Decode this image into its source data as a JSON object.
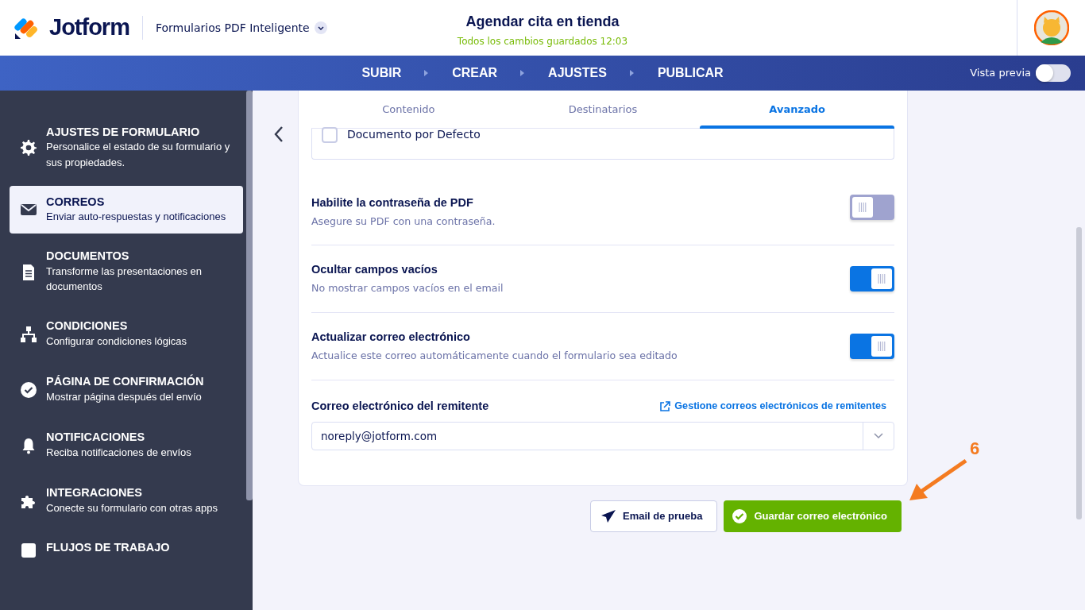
{
  "header": {
    "brand": "Jotform",
    "form_type": "Formularios PDF Inteligente",
    "title": "Agendar cita en tienda",
    "save_status": "Todos los cambios guardados 12:03"
  },
  "steps": [
    {
      "label": "SUBIR",
      "selected": false
    },
    {
      "label": "CREAR",
      "selected": false
    },
    {
      "label": "AJUSTES",
      "selected": false
    },
    {
      "label": "PUBLICAR",
      "selected": false
    }
  ],
  "preview": {
    "label": "Vista previa",
    "on": false
  },
  "sidebar": {
    "items": [
      {
        "kind": "gear",
        "title": "AJUSTES DE FORMULARIO",
        "subtitle": "Personalice el estado de su formulario y sus propiedades.",
        "selected": false
      },
      {
        "kind": "mail",
        "title": "CORREOS",
        "subtitle": "Enviar auto-respuestas y notificaciones",
        "selected": true
      },
      {
        "kind": "doc",
        "title": "DOCUMENTOS",
        "subtitle": "Transforme las presentaciones en documentos",
        "selected": false
      },
      {
        "kind": "tree",
        "title": "CONDICIONES",
        "subtitle": "Configurar condiciones lógicas",
        "selected": false
      },
      {
        "kind": "check",
        "title": "PÁGINA DE CONFIRMACIÓN",
        "subtitle": "Mostrar página después del envío",
        "selected": false
      },
      {
        "kind": "bell",
        "title": "NOTIFICACIONES",
        "subtitle": "Reciba notificaciones de envíos",
        "selected": false
      },
      {
        "kind": "puzzle",
        "title": "INTEGRACIONES",
        "subtitle": "Conecte su formulario con otras apps",
        "selected": false
      },
      {
        "kind": "flow",
        "title": "FLUJOS DE TRABAJO",
        "selected": false
      }
    ]
  },
  "tabs": [
    {
      "label": "Contenido",
      "selected": false
    },
    {
      "label": "Destinatarios",
      "selected": false
    },
    {
      "label": "Avanzado",
      "selected": true
    }
  ],
  "default_document": {
    "label": "Documento por Defecto",
    "checked": false
  },
  "settings": [
    {
      "title": "Habilite la contraseña de PDF",
      "description": "Asegure su PDF con una contraseña.",
      "on": false
    },
    {
      "title": "Ocultar campos vacíos",
      "description": "No mostrar campos vacíos en el email",
      "on": true
    },
    {
      "title": "Actualizar correo electrónico",
      "description": "Actualice este correo automáticamente cuando el formulario sea editado",
      "on": true
    }
  ],
  "sender": {
    "label": "Correo electrónico del remitente",
    "manage_link": "Gestione correos electrónicos de remitentes",
    "value": "noreply@jotform.com"
  },
  "buttons": {
    "test": "Email de prueba",
    "save": "Guardar correo electrónico"
  },
  "annotation": {
    "number": "6"
  }
}
